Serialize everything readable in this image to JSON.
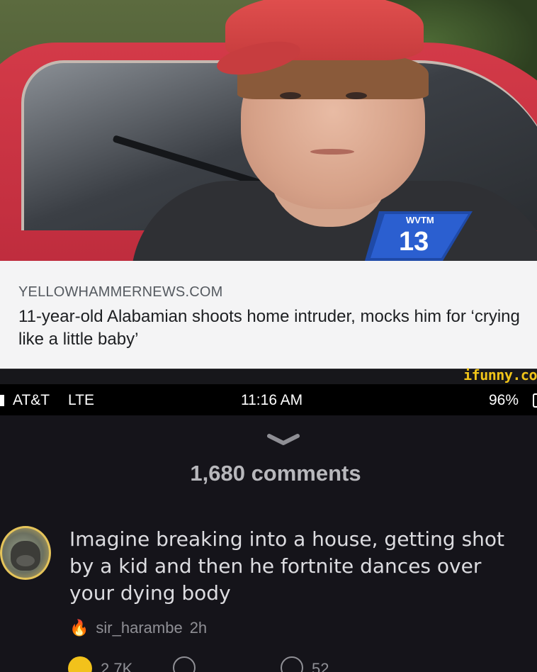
{
  "news": {
    "station_logo": "WVTM",
    "station_number": "13",
    "source": "YELLOWHAMMERNEWS.COM",
    "headline": "11-year-old Alabamian shoots home intruder, mocks him for ‘crying like a little baby’"
  },
  "watermark": "ifunny.co",
  "statusbar": {
    "carrier": "AT&T",
    "network": "LTE",
    "time": "11:16 AM",
    "battery": "96%"
  },
  "comments": {
    "count_label": "1,680 comments",
    "items": [
      {
        "text": "Imagine breaking into a house, getting shot by a kid and then he fortnite dances over your dying body",
        "username": "sir_harambe",
        "age": "2h",
        "smile_count": "2.7K",
        "reply_count": "52"
      }
    ]
  },
  "colors": {
    "accent_yellow": "#f0c419",
    "background_dark": "#15141a",
    "article_bg": "#f4f4f5",
    "fire_orange": "#f0a81a"
  }
}
